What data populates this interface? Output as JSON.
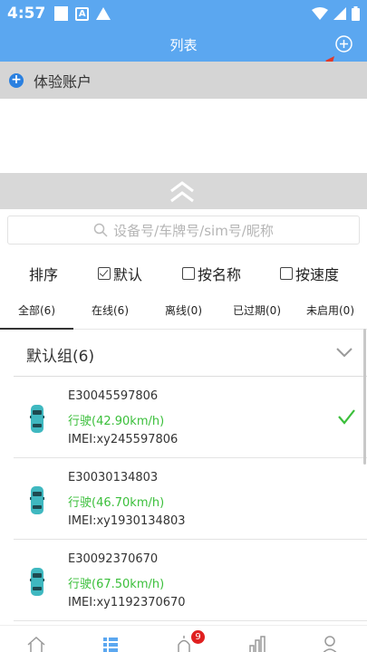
{
  "status_bar": {
    "time": "4:57",
    "left_icons": [
      "square-icon",
      "a-icon",
      "warning-icon"
    ],
    "right_icons": [
      "wifi-icon",
      "signal-icon",
      "battery-icon"
    ]
  },
  "header": {
    "title": "列表",
    "add_icon": "add-circle-icon"
  },
  "account": {
    "name": "体验账户"
  },
  "search": {
    "placeholder": "设备号/车牌号/sim号/昵称"
  },
  "sort": {
    "label": "排序",
    "options": [
      {
        "label": "默认",
        "checked": true
      },
      {
        "label": "按名称",
        "checked": false
      },
      {
        "label": "按速度",
        "checked": false
      }
    ]
  },
  "tabs": [
    {
      "label": "全部(6)",
      "active": true
    },
    {
      "label": "在线(6)",
      "active": false
    },
    {
      "label": "离线(0)",
      "active": false
    },
    {
      "label": "已过期(0)",
      "active": false
    },
    {
      "label": "未启用(0)",
      "active": false
    }
  ],
  "group": {
    "name": "默认组(6)"
  },
  "vehicles": [
    {
      "name": "E30045597806",
      "status": "行驶(42.90km/h)",
      "imei": "IMEI:xy245597806",
      "selected": true
    },
    {
      "name": "E30030134803",
      "status": "行驶(46.70km/h)",
      "imei": "IMEI:xy1930134803",
      "selected": false
    },
    {
      "name": "E30092370670",
      "status": "行驶(67.50km/h)",
      "imei": "IMEI:xy1192370670",
      "selected": false
    }
  ],
  "bottom_nav": {
    "items": [
      "home-icon",
      "list-icon",
      "alarm-icon",
      "stats-icon",
      "profile-icon"
    ],
    "alarm_badge": "9"
  },
  "colors": {
    "primary": "#5ba7f0",
    "moving": "#3bbf3b",
    "badge": "#e02020",
    "car": "#3fb8c0"
  }
}
